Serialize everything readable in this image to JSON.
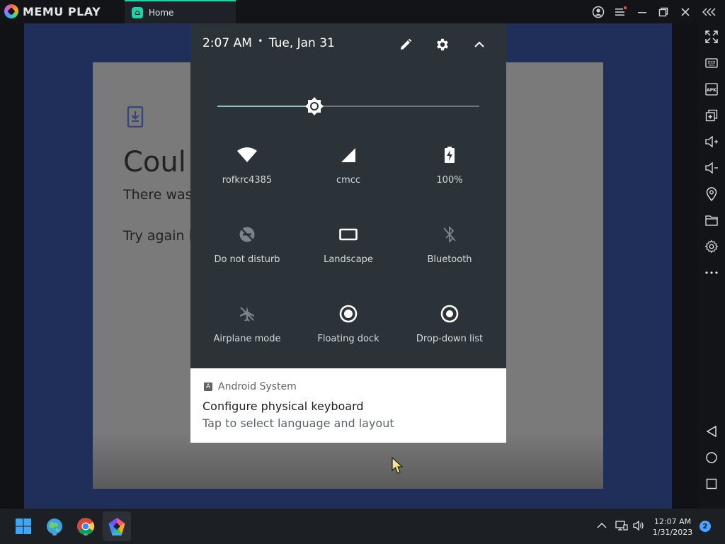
{
  "titlebar": {
    "app_name": "MEMU PLAY",
    "tab_label": "Home",
    "tab_icon": "memu-home-icon"
  },
  "sidebar": {
    "icons": [
      "fullscreen-icon",
      "keyboard-icon",
      "apk-icon",
      "multi-instance-icon",
      "volume-up-icon",
      "volume-down-icon",
      "location-icon",
      "folder-icon",
      "settings-icon",
      "more-icon",
      "back-icon",
      "home-icon",
      "recents-icon"
    ],
    "apk_label": "APK"
  },
  "background_app": {
    "title": "Coul",
    "description": "There was",
    "retry": "Try again la"
  },
  "shade": {
    "time": "2:07 AM",
    "separator": "•",
    "date": "Tue, Jan 31",
    "brightness": 0.37,
    "tiles": [
      {
        "label": "rofkrc4385",
        "icon": "wifi-icon",
        "active": true
      },
      {
        "label": "cmcc",
        "icon": "cell-signal-icon",
        "active": true
      },
      {
        "label": "100%",
        "icon": "battery-icon",
        "active": true
      },
      {
        "label": "Do not disturb",
        "icon": "do-not-disturb-icon",
        "active": false
      },
      {
        "label": "Landscape",
        "icon": "landscape-icon",
        "active": true
      },
      {
        "label": "Bluetooth",
        "icon": "bluetooth-icon",
        "active": false
      },
      {
        "label": "Airplane mode",
        "icon": "airplane-icon",
        "active": false
      },
      {
        "label": "Floating dock",
        "icon": "floating-dock-icon",
        "active": true
      },
      {
        "label": "Drop-down list",
        "icon": "drop-down-list-icon",
        "active": true
      }
    ]
  },
  "notification": {
    "app": "Android System",
    "app_icon_letter": "A",
    "title": "Configure physical keyboard",
    "text": "Tap to select language and layout"
  },
  "taskbar": {
    "clock_time": "12:07 AM",
    "clock_date": "1/31/2023",
    "notification_count": "2"
  },
  "colors": {
    "accent": "#1fd3a6",
    "shade_bg": "#2c3338",
    "emu_bg": "#1f2f5a",
    "taskbar_bg": "#1c1f24"
  }
}
